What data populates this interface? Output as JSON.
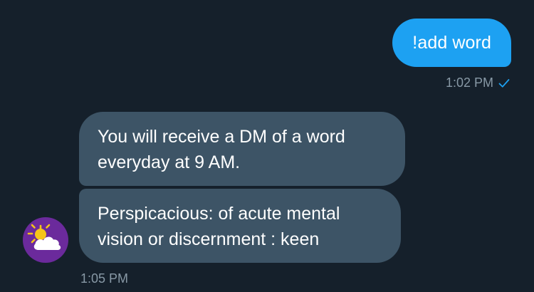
{
  "conversation": {
    "sent_messages": [
      {
        "text": "!add word",
        "time": "1:02 PM",
        "status_icon": "check-icon",
        "bubble_color": "#1da1f2"
      }
    ],
    "received_messages": [
      {
        "lines": [
          "You will receive a DM of a word",
          "everyday at 9 AM."
        ],
        "bubble_color": "#3d5466"
      },
      {
        "lines": [
          "Perspicacious: of acute mental",
          "vision or discernment : keen"
        ],
        "bubble_color": "#3d5466"
      }
    ],
    "received_time": "1:05 PM",
    "sender_avatar": {
      "icon": "sun-behind-cloud-icon",
      "background_color": "#6b2a9c"
    }
  },
  "theme": {
    "background": "#15202b",
    "meta_text_color": "#8899a6",
    "accent": "#1da1f2"
  }
}
